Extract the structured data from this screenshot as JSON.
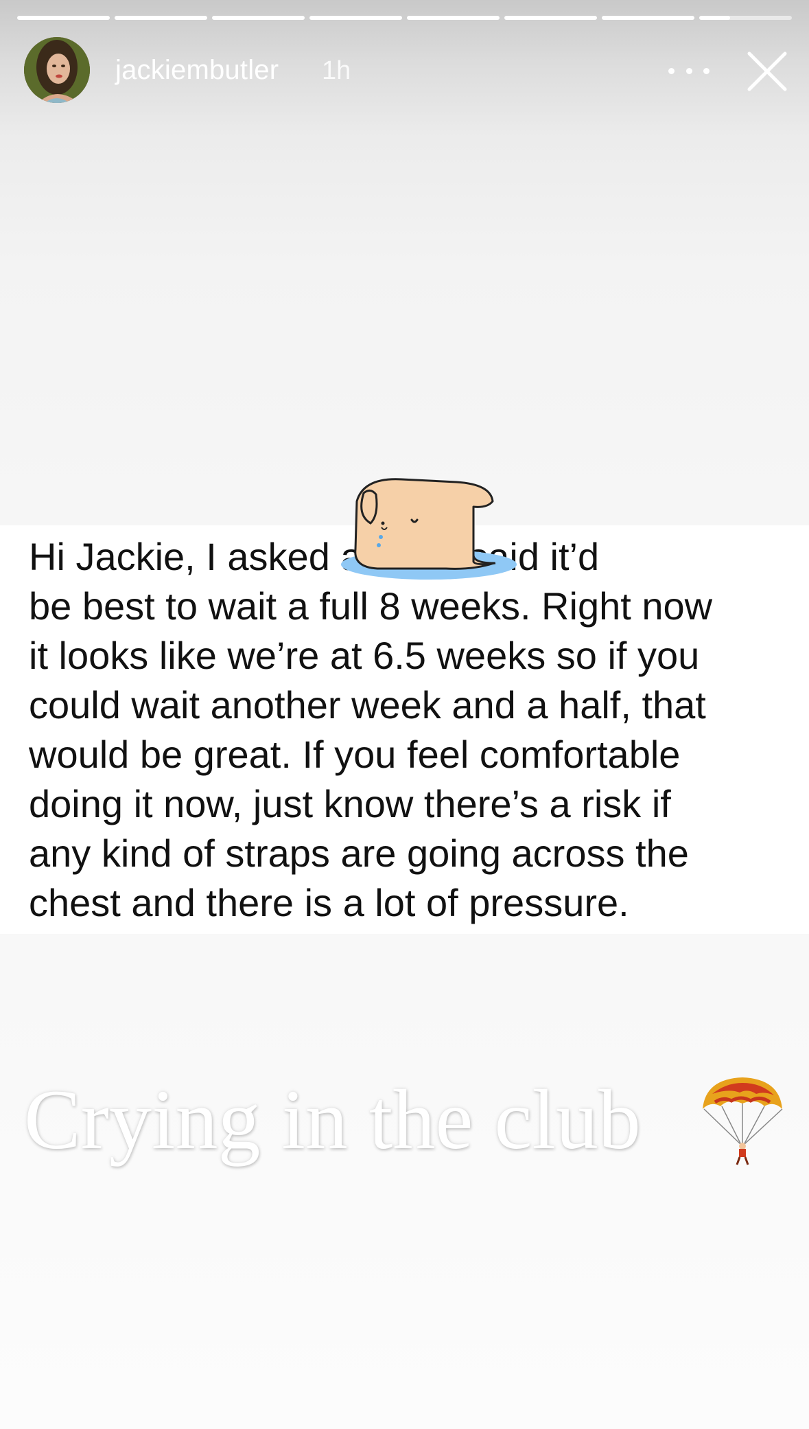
{
  "story": {
    "segment_count": 8,
    "segments_completed": 7,
    "current_segment_progress": 0.33,
    "username": "jackiembutler",
    "time_ago": "1h"
  },
  "header": {
    "more_icon": "more-horizontal-icon",
    "close_icon": "close-icon"
  },
  "message": {
    "text": "Hi Jackie, I asked             and he said it’d\nbe best to wait a full 8 weeks. Right now\nit looks like we’re at 6.5 weeks so if you\ncould wait another week and a half, that\nwould be great. If you feel comfortable\ndoing it now, just know there’s a risk if\nany kind of straps are going across the\nchest and there is a lot of pressure."
  },
  "sticker": {
    "icon": "crying-dog-sticker-icon"
  },
  "caption": {
    "text": "Crying in the club",
    "emoji_icon": "parachute-icon"
  },
  "colors": {
    "background_top": "#c9c9c9",
    "background_bottom": "#fcfcfc",
    "card": "#ffffff",
    "text": "#111111",
    "sticker_body": "#f6d0a8",
    "sticker_puddle": "#8fc8f5"
  }
}
